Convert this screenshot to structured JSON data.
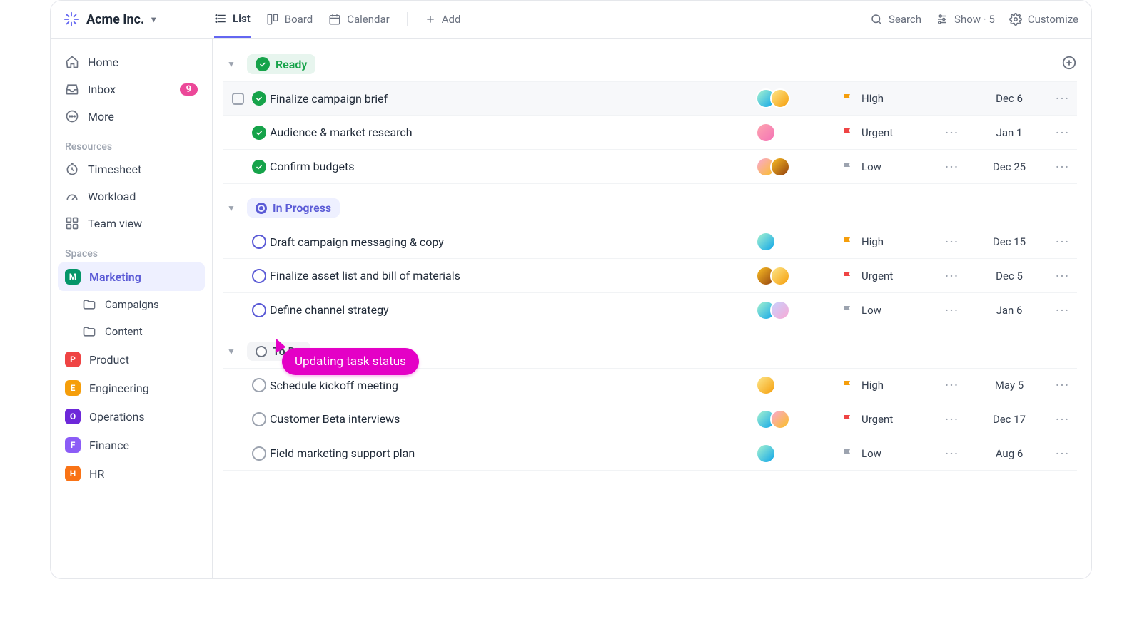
{
  "org": {
    "name": "Acme Inc."
  },
  "views": {
    "list": "List",
    "board": "Board",
    "calendar": "Calendar",
    "add": "Add"
  },
  "topActions": {
    "search": "Search",
    "show": "Show · 5",
    "customize": "Customize"
  },
  "sidebar": {
    "nav": {
      "home": "Home",
      "inbox": "Inbox",
      "inbox_badge": "9",
      "more": "More"
    },
    "resources_heading": "Resources",
    "resources": {
      "timesheet": "Timesheet",
      "workload": "Workload",
      "teamview": "Team view"
    },
    "spaces_heading": "Spaces",
    "spaces": {
      "marketing": {
        "letter": "M",
        "label": "Marketing",
        "color": "#059669"
      },
      "campaigns": "Campaigns",
      "content": "Content",
      "product": {
        "letter": "P",
        "label": "Product",
        "color": "#ef4444"
      },
      "engineering": {
        "letter": "E",
        "label": "Engineering",
        "color": "#f59e0b"
      },
      "operations": {
        "letter": "O",
        "label": "Operations",
        "color": "#6d28d9"
      },
      "finance": {
        "letter": "F",
        "label": "Finance",
        "color": "#8b5cf6"
      },
      "hr": {
        "letter": "H",
        "label": "HR",
        "color": "#f97316"
      }
    }
  },
  "groups": {
    "ready": {
      "label": "Ready",
      "pill_bg": "#e7f5ee",
      "pill_fg": "#16a34a",
      "tasks": [
        {
          "title": "Finalize campaign brief",
          "priority": "High",
          "prio_class": "high",
          "date": "Dec 6",
          "show_check": true,
          "show_extra": false
        },
        {
          "title": "Audience & market research",
          "priority": "Urgent",
          "prio_class": "urgent",
          "date": "Jan 1",
          "show_check": false,
          "show_extra": true
        },
        {
          "title": "Confirm budgets",
          "priority": "Low",
          "prio_class": "low",
          "date": "Dec 25",
          "show_check": false,
          "show_extra": true
        }
      ]
    },
    "inprogress": {
      "label": "In Progress",
      "pill_bg": "#eef0ff",
      "pill_fg": "#5b5bd6",
      "tasks": [
        {
          "title": "Draft campaign messaging & copy",
          "priority": "High",
          "prio_class": "high",
          "date": "Dec 15",
          "show_extra": true
        },
        {
          "title": "Finalize asset list and bill of materials",
          "priority": "Urgent",
          "prio_class": "urgent",
          "date": "Dec 5",
          "show_extra": true
        },
        {
          "title": "Define channel strategy",
          "priority": "Low",
          "prio_class": "low",
          "date": "Jan 6",
          "show_extra": true
        }
      ]
    },
    "todo": {
      "label": "To Do",
      "pill_bg": "#f3f4f6",
      "pill_fg": "#374151",
      "tasks": [
        {
          "title": "Schedule kickoff meeting",
          "priority": "High",
          "prio_class": "high",
          "date": "May 5",
          "show_extra": true
        },
        {
          "title": "Customer Beta interviews",
          "priority": "Urgent",
          "prio_class": "urgent",
          "date": "Dec 17",
          "show_extra": true
        },
        {
          "title": "Field marketing support plan",
          "priority": "Low",
          "prio_class": "low",
          "date": "Aug 6",
          "show_extra": true
        }
      ]
    }
  },
  "tooltip": "Updating task status"
}
